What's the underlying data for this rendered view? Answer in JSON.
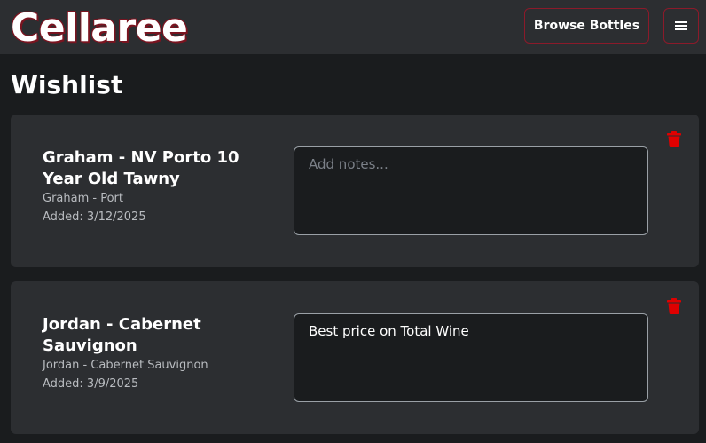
{
  "app": {
    "brand": "Cellaree",
    "browse_label": "Browse Bottles"
  },
  "page": {
    "title": "Wishlist"
  },
  "wishlist": [
    {
      "name": "Graham - NV Porto 10 Year Old Tawny",
      "subtitle": "Graham - Port",
      "added": "Added: 3/12/2025",
      "notes_value": "",
      "notes_placeholder": "Add notes..."
    },
    {
      "name": "Jordan - Cabernet Sauvignon",
      "subtitle": "Jordan - Cabernet Sauvignon",
      "added": "Added: 3/9/2025",
      "notes_value": "Best price on Total Wine",
      "notes_placeholder": "Add notes..."
    }
  ],
  "icons": {
    "menu": "hamburger-menu-icon",
    "delete": "trash-icon"
  },
  "colors": {
    "accent": "#8b1a2a",
    "delete": "#e00000",
    "card_bg": "#2c2e31",
    "page_bg": "#1a1c1e"
  }
}
